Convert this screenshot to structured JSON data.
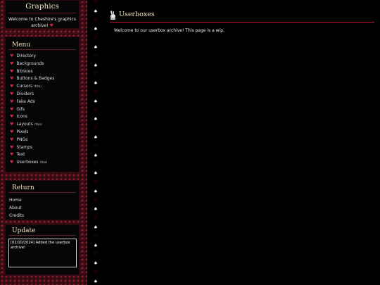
{
  "sidebar": {
    "graphics": {
      "title": "Graphics",
      "welcome": "Welcome to Cheshire's graphics archive!",
      "heart": "♥"
    },
    "menu": {
      "title": "Menu",
      "items": [
        {
          "label": "Directory",
          "tag": ""
        },
        {
          "label": "Backgrounds",
          "tag": ""
        },
        {
          "label": "Blinkies",
          "tag": ""
        },
        {
          "label": "Buttons & Badges",
          "tag": ""
        },
        {
          "label": "Cursors",
          "tag": "(tba)"
        },
        {
          "label": "Dividers",
          "tag": ""
        },
        {
          "label": "Fake Ads",
          "tag": ""
        },
        {
          "label": "Gifs",
          "tag": ""
        },
        {
          "label": "Icons",
          "tag": ""
        },
        {
          "label": "Layouts",
          "tag": "(tba)"
        },
        {
          "label": "Pixels",
          "tag": ""
        },
        {
          "label": "PNGs",
          "tag": ""
        },
        {
          "label": "Stamps",
          "tag": ""
        },
        {
          "label": "Text",
          "tag": ""
        },
        {
          "label": "Userboxes",
          "tag": "(tba)"
        }
      ]
    },
    "return": {
      "title": "Return",
      "items": [
        "Home",
        "About",
        "Credits"
      ]
    },
    "update": {
      "title": "Update",
      "text": "[02/10/2024] Added the userbox archive!"
    }
  },
  "main": {
    "title": "Userboxes",
    "intro": "Welcome to our userbox archive! This page is a wip."
  },
  "colors": {
    "accent": "#c01a28",
    "heading": "#f0e0c0",
    "background": "#000000",
    "sidebar_pattern": "#3a0c14"
  },
  "icons": {
    "menu_bullet": "heart-icon",
    "title_icon": "bunny-icon",
    "divider_white": "spade-icon",
    "divider_red": "heart-icon"
  }
}
